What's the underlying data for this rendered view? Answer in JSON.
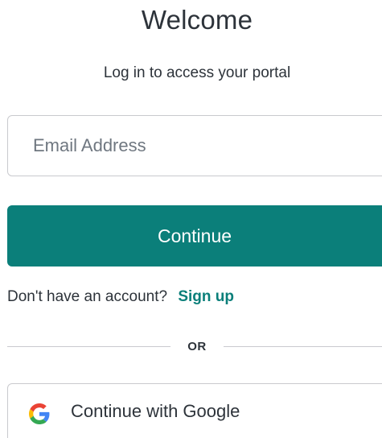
{
  "header": {
    "title": "Welcome",
    "subtitle": "Log in to access your portal"
  },
  "form": {
    "email_placeholder": "Email Address",
    "email_value": "",
    "continue_label": "Continue"
  },
  "signup": {
    "prompt": "Don't have an account?",
    "link_label": "Sign up"
  },
  "divider": {
    "label": "OR"
  },
  "social": {
    "google_label": "Continue with Google",
    "google_icon": "google-g-logo"
  },
  "colors": {
    "accent": "#0b7f7a",
    "text": "#2d333a",
    "border": "#c9cace",
    "placeholder": "#6f7780"
  }
}
